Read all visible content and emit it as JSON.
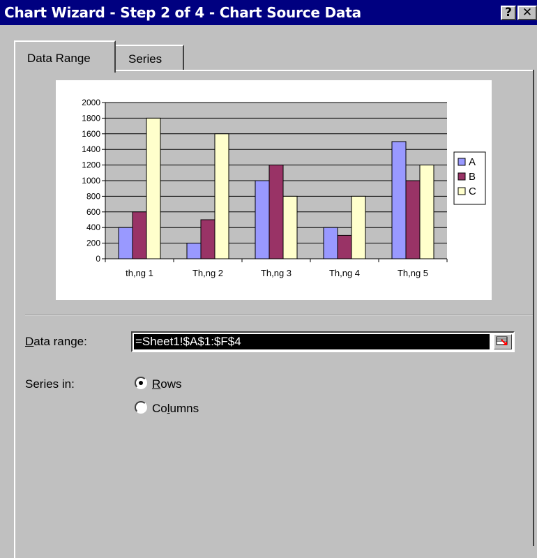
{
  "window": {
    "title": "Chart Wizard - Step 2 of 4 - Chart Source Data",
    "help_label": "?",
    "close_label": "✕"
  },
  "tabs": [
    {
      "label": "Data Range",
      "active": true
    },
    {
      "label": "Series",
      "active": false
    }
  ],
  "chart_data": {
    "type": "bar",
    "categories": [
      "th,ng 1",
      "Th,ng 2",
      "Th,ng 3",
      "Th,ng 4",
      "Th,ng 5"
    ],
    "series": [
      {
        "name": "A",
        "color": "#9999ff",
        "values": [
          400,
          200,
          1000,
          400,
          1500
        ]
      },
      {
        "name": "B",
        "color": "#993366",
        "values": [
          600,
          500,
          1200,
          300,
          1000
        ]
      },
      {
        "name": "C",
        "color": "#ffffcc",
        "values": [
          1800,
          1600,
          800,
          800,
          1200
        ]
      }
    ],
    "ylim": [
      0,
      2000
    ],
    "yticks": [
      0,
      200,
      400,
      600,
      800,
      1000,
      1200,
      1400,
      1600,
      1800,
      2000
    ],
    "grid": true,
    "plot_bg": "#c0c0c0",
    "legend": "right"
  },
  "form": {
    "data_range_label_first": "D",
    "data_range_label_rest": "ata range:",
    "data_range_value": "=Sheet1!$A$1:$F$4",
    "series_in_label": "Series in:",
    "rows_label_first": "R",
    "rows_label_rest": "ows",
    "columns_label_pre": "Co",
    "columns_label_u": "l",
    "columns_label_rest": "umns",
    "selected": "rows"
  }
}
